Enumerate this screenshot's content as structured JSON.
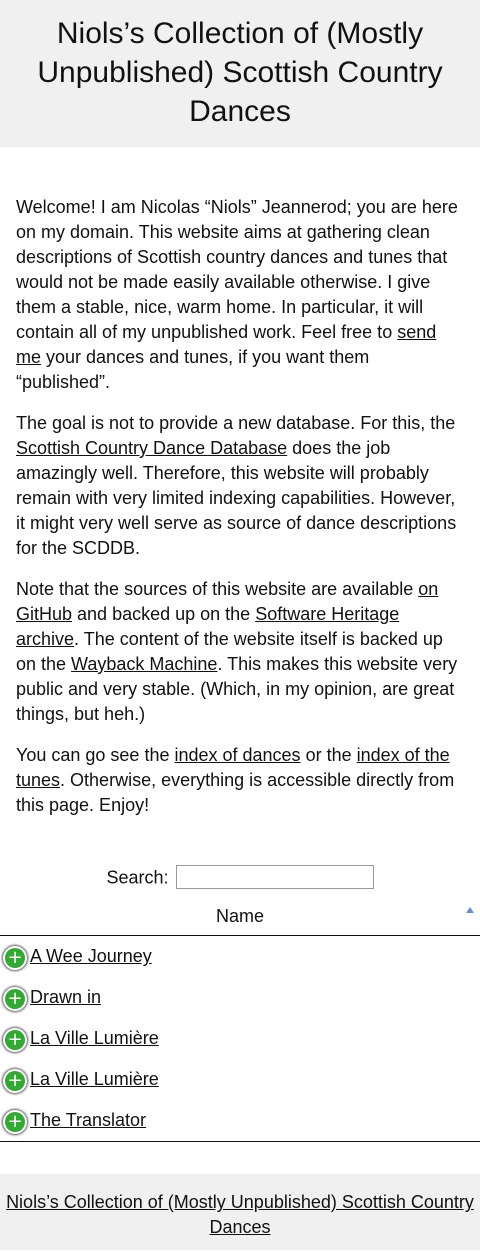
{
  "header": {
    "title": "Niols’s Collection of (Mostly Unpublished) Scottish Country Dances"
  },
  "intro": {
    "p1": {
      "text_a": "Welcome! I am Nicolas “Niols” Jeannerod; you are here on my domain. This website aims at gathering clean descriptions of Scottish country dances and tunes that would not be made easily available otherwise. I give them a stable, nice, warm home. In particular, it will contain all of my unpublished work. Feel free to ",
      "link_send_me": "send me",
      "text_b": " your dances and tunes, if you want them “published”."
    },
    "p2": {
      "text_a": "The goal is not to provide a new database. For this, the ",
      "link_scddb": "Scottish Country Dance Database",
      "text_b": " does the job amazingly well. Therefore, this website will probably remain with very limited indexing capabilities. However, it might very well serve as source of dance descriptions for the SCDDB."
    },
    "p3": {
      "text_a": "Note that the sources of this website are available ",
      "link_github": "on GitHub",
      "text_b": " and backed up on the ",
      "link_swh": "Software Heritage archive",
      "text_c": ". The content of the website itself is backed up on the ",
      "link_wayback": "Wayback Machine",
      "text_d": ". This makes this website very public and very stable. (Which, in my opinion, are great things, but heh.)"
    },
    "p4": {
      "text_a": "You can go see the ",
      "link_dances": "index of dances",
      "text_b": " or the ",
      "link_tunes": "index of the tunes",
      "text_c": ". Otherwise, everything is accessible directly from this page. Enjoy!"
    }
  },
  "search": {
    "label": "Search:",
    "value": ""
  },
  "table": {
    "column_name": "Name",
    "expand_symbol": "+",
    "rows": [
      "A Wee Journey",
      "Drawn in",
      "La Ville Lumière",
      "La Ville Lumière",
      "The Translator"
    ]
  },
  "footer": {
    "link": "Niols’s Collection of (Mostly Unpublished) Scottish Country Dances"
  },
  "colors": {
    "header_bg": "#f0f0f0",
    "expand_icon": "#36a636",
    "sort_icon": "#6c8ec8"
  }
}
